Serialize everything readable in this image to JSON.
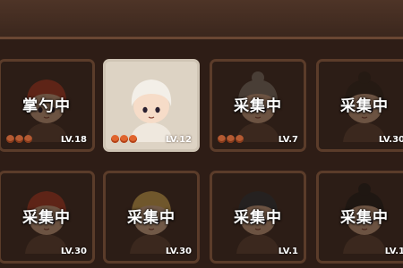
{
  "roster": {
    "cards": [
      {
        "status": "掌勺中",
        "level": "LV.18",
        "hearts": 3,
        "selected": false,
        "hair": "#b8422c",
        "skin": "#d8a989",
        "portrait": "red-hair-girl"
      },
      {
        "status": "",
        "level": "LV.12",
        "hearts": 3,
        "selected": true,
        "hair": "#f3efe8",
        "skin": "#f6dcc8",
        "portrait": "white-hair-girl"
      },
      {
        "status": "采集中",
        "level": "LV.7",
        "hearts": 3,
        "selected": false,
        "hair": "#8a7a70",
        "skin": "#d8a989",
        "portrait": "bun-hair-elder"
      },
      {
        "status": "采集中",
        "level": "LV.30",
        "hearts": 0,
        "selected": false,
        "hair": "#3a2a22",
        "skin": "#d8a989",
        "portrait": "dark-bun-man"
      },
      {
        "status": "采集中",
        "level": "LV.30",
        "hearts": 0,
        "selected": false,
        "hair": "#b8422c",
        "skin": "#d8a989",
        "portrait": "red-hair-boy"
      },
      {
        "status": "采集中",
        "level": "LV.30",
        "hearts": 0,
        "selected": false,
        "hair": "#e0b25a",
        "skin": "#e2b695",
        "portrait": "blond-spiky-boy"
      },
      {
        "status": "采集中",
        "level": "LV.1",
        "hearts": 0,
        "selected": false,
        "hair": "#3b3b3f",
        "skin": "#d8a989",
        "portrait": "dark-hair-boy"
      },
      {
        "status": "采集中",
        "level": "LV.1",
        "hearts": 0,
        "selected": false,
        "hair": "#2e2420",
        "skin": "#d8a989",
        "portrait": "topknot-man"
      }
    ]
  }
}
